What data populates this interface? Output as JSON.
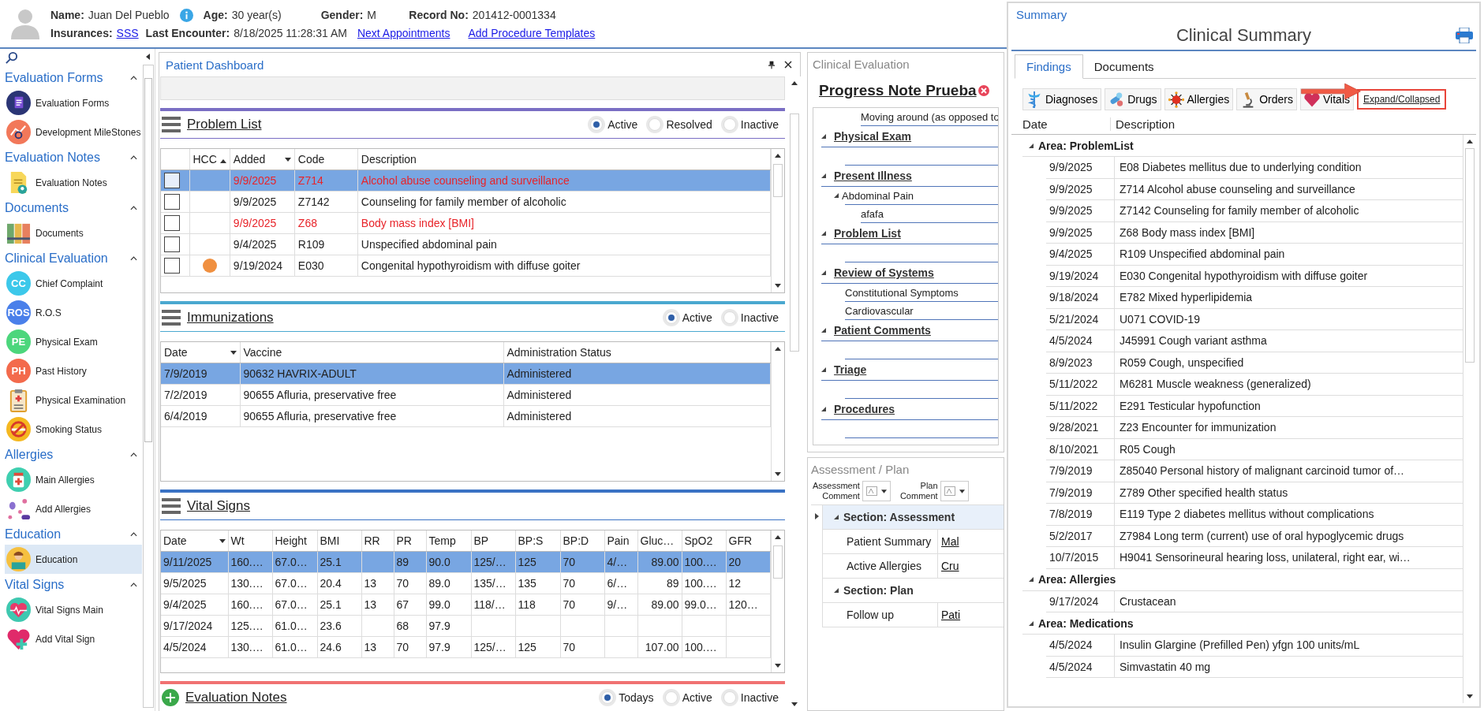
{
  "patient": {
    "name_label": "Name:",
    "name": "Juan Del Pueblo",
    "age_label": "Age:",
    "age": "30 year(s)",
    "gender_label": "Gender:",
    "gender": "M",
    "record_label": "Record No:",
    "record": "201412-0001334",
    "insurances_label": "Insurances:",
    "insurance": "SSS",
    "last_encounter_label": "Last Encounter:",
    "last_encounter": "8/18/2025 11:28:31 AM",
    "links": [
      "Next Appointments",
      "Add Procedure Templates"
    ]
  },
  "sidebar": {
    "groups": [
      {
        "title": "Evaluation Forms",
        "items": [
          {
            "label": "Evaluation Forms",
            "kind": "form",
            "selected": false
          },
          {
            "label": "Development MileStones",
            "kind": "milestones",
            "selected": false
          }
        ]
      },
      {
        "title": "Evaluation Notes",
        "items": [
          {
            "label": "Evaluation Notes",
            "kind": "note",
            "selected": false
          }
        ]
      },
      {
        "title": "Documents",
        "items": [
          {
            "label": "Documents",
            "kind": "binders",
            "selected": false
          }
        ]
      },
      {
        "title": "Clinical Evaluation",
        "items": [
          {
            "label": "Chief Complaint",
            "kind": "badge",
            "badge": "CC",
            "color": "#3cc8ea",
            "selected": false
          },
          {
            "label": "R.O.S",
            "kind": "badge",
            "badge": "ROS",
            "color": "#4a80ea",
            "selected": false
          },
          {
            "label": "Physical Exam",
            "kind": "badge",
            "badge": "PE",
            "color": "#4cd67c",
            "selected": false
          },
          {
            "label": "Past History",
            "kind": "badge",
            "badge": "PH",
            "color": "#f36a4c",
            "selected": false
          },
          {
            "label": "Physical Examination",
            "kind": "clipboard",
            "selected": false
          },
          {
            "label": "Smoking Status",
            "kind": "smoking",
            "selected": false
          }
        ]
      },
      {
        "title": "Allergies",
        "items": [
          {
            "label": "Main Allergies",
            "kind": "medicine",
            "selected": false
          },
          {
            "label": "Add Allergies",
            "kind": "pills",
            "selected": false
          }
        ]
      },
      {
        "title": "Education",
        "items": [
          {
            "label": "Education",
            "kind": "reader",
            "selected": true
          }
        ]
      },
      {
        "title": "Vital Signs",
        "items": [
          {
            "label": "Vital Signs Main",
            "kind": "heart-monitor",
            "selected": false
          },
          {
            "label": "Add Vital Sign",
            "kind": "heart-plus",
            "selected": false
          }
        ]
      }
    ]
  },
  "dashboard": {
    "title": "Patient Dashboard",
    "problem_list": {
      "title": "Problem List",
      "filters": [
        {
          "label": "Active",
          "selected": true
        },
        {
          "label": "Resolved",
          "selected": false
        },
        {
          "label": "Inactive",
          "selected": false
        }
      ],
      "columns": [
        "HCC",
        "Added",
        "Code",
        "Description"
      ],
      "rows": [
        {
          "selected": true,
          "checked": false,
          "hcc": false,
          "alert": true,
          "added": "9/9/2025",
          "code": "Z714",
          "description": "Alcohol abuse counseling and surveillance"
        },
        {
          "selected": false,
          "checked": false,
          "hcc": false,
          "alert": false,
          "added": "9/9/2025",
          "code": "Z7142",
          "description": "Counseling for family member of alcoholic"
        },
        {
          "selected": false,
          "checked": false,
          "hcc": false,
          "alert": true,
          "added": "9/9/2025",
          "code": "Z68",
          "description": "Body mass index [BMI]"
        },
        {
          "selected": false,
          "checked": false,
          "hcc": false,
          "alert": false,
          "added": "9/4/2025",
          "code": "R109",
          "description": "Unspecified abdominal pain"
        },
        {
          "selected": false,
          "checked": false,
          "hcc": true,
          "alert": false,
          "added": "9/19/2024",
          "code": "E030",
          "description": "Congenital hypothyroidism with diffuse goiter"
        }
      ]
    },
    "immunizations": {
      "title": "Immunizations",
      "filters": [
        {
          "label": "Active",
          "selected": true
        },
        {
          "label": "Inactive",
          "selected": false
        }
      ],
      "columns": [
        "Date",
        "Vaccine",
        "Administration Status"
      ],
      "rows": [
        {
          "selected": true,
          "date": "7/9/2019",
          "vaccine": "90632 HAVRIX-ADULT",
          "status": "Administered"
        },
        {
          "selected": false,
          "date": "7/2/2019",
          "vaccine": "90655 Afluria, preservative free",
          "status": "Administered"
        },
        {
          "selected": false,
          "date": "6/4/2019",
          "vaccine": "90655 Afluria, preservative free",
          "status": "Administered"
        }
      ]
    },
    "vital_signs": {
      "title": "Vital Signs",
      "columns": [
        "Date",
        "Wt",
        "Height",
        "BMI",
        "RR",
        "PR",
        "Temp",
        "BP",
        "BP:S",
        "BP:D",
        "Pain",
        "Gluc…",
        "SpO2",
        "GFR"
      ],
      "rows": [
        {
          "selected": true,
          "cells": [
            "9/11/2025",
            "160.…",
            "67.0…",
            "25.1",
            null,
            "89",
            "90.0",
            "125/…",
            "125",
            "70",
            "4/…",
            "89.00",
            "100.…",
            "20"
          ]
        },
        {
          "selected": false,
          "cells": [
            "9/5/2025",
            "130.…",
            "67.0…",
            "20.4",
            "13",
            "70",
            "89.0",
            "135/…",
            "135",
            "70",
            "6/…",
            "89",
            "100.…",
            "12"
          ]
        },
        {
          "selected": false,
          "cells": [
            "9/4/2025",
            "160.…",
            "67.0…",
            "25.1",
            "13",
            "67",
            "99.0",
            "118/…",
            "118",
            "70",
            "9/…",
            "89.00",
            "99.0…",
            "120…"
          ]
        },
        {
          "selected": false,
          "cells": [
            "9/17/2024",
            "125.…",
            "61.0…",
            "23.6",
            null,
            "68",
            "97.9",
            null,
            null,
            null,
            null,
            null,
            null,
            null
          ]
        },
        {
          "selected": false,
          "cells": [
            "4/5/2024",
            "130.…",
            "61.0…",
            "24.6",
            "13",
            "70",
            "97.9",
            "125/…",
            "125",
            "70",
            null,
            "107.00",
            "100.…",
            null
          ]
        }
      ]
    },
    "evaluation_notes": {
      "title": "Evaluation Notes",
      "filters": [
        {
          "label": "Todays",
          "selected": true
        },
        {
          "label": "Active",
          "selected": false
        },
        {
          "label": "Inactive",
          "selected": false
        }
      ]
    }
  },
  "clinical_evaluation": {
    "title": "Clinical Evaluation",
    "note_title": "Progress Note Prueba",
    "top_line": "Moving around (as opposed to",
    "sections": [
      {
        "label": "Physical Exam",
        "expanded": true
      },
      {
        "label": "Present Illness",
        "expanded": true,
        "children": [
          {
            "label": "Abdominal Pain",
            "expanded": true,
            "children": [
              {
                "label": "afafa"
              }
            ]
          }
        ]
      },
      {
        "label": "Problem List",
        "expanded": true
      },
      {
        "label": "Review of Systems",
        "expanded": true,
        "children": [
          {
            "label": "Constitutional Symptoms"
          },
          {
            "label": "Cardiovascular"
          }
        ]
      },
      {
        "label": "Patient Comments",
        "expanded": true
      },
      {
        "label": "Triage",
        "expanded": true
      },
      {
        "label": "Procedures",
        "expanded": true
      }
    ]
  },
  "assessment_plan": {
    "title": "Assessment / Plan",
    "comment_controls": [
      {
        "label_1": "Assessment",
        "label_2": "Comment"
      },
      {
        "label_1": "Plan",
        "label_2": "Comment"
      }
    ],
    "sections": [
      {
        "label": "Section: Assessment",
        "expanded": true,
        "rows": [
          {
            "label": "Patient Summary",
            "value": "Mal"
          },
          {
            "label": "Active Allergies",
            "value": "Cru"
          }
        ]
      },
      {
        "label": "Section: Plan",
        "expanded": true,
        "rows": [
          {
            "label": "Follow up",
            "value": "Pati"
          }
        ]
      }
    ]
  },
  "summary": {
    "title": "Summary",
    "heading": "Clinical Summary",
    "tabs": [
      {
        "label": "Findings",
        "selected": true
      },
      {
        "label": "Documents",
        "selected": false
      }
    ],
    "toolbar": [
      {
        "label": "Diagnoses",
        "kind": "caduceus"
      },
      {
        "label": "Drugs",
        "kind": "pills"
      },
      {
        "label": "Allergies",
        "kind": "virus"
      },
      {
        "label": "Orders",
        "kind": "microscope"
      },
      {
        "label": "Vitals",
        "kind": "heart"
      }
    ],
    "expand_link": "Expand/Collapsed",
    "columns": [
      "Date",
      "Description"
    ],
    "areas": [
      {
        "title": "Area: ProblemList",
        "expanded": true,
        "rows": [
          {
            "date": "9/9/2025",
            "description": "E08 Diabetes mellitus due to underlying condition"
          },
          {
            "date": "9/9/2025",
            "description": "Z714 Alcohol abuse counseling and surveillance"
          },
          {
            "date": "9/9/2025",
            "description": "Z7142 Counseling for family member of alcoholic"
          },
          {
            "date": "9/9/2025",
            "description": "Z68 Body mass index [BMI]"
          },
          {
            "date": "9/4/2025",
            "description": "R109 Unspecified abdominal pain"
          },
          {
            "date": "9/19/2024",
            "description": "E030 Congenital hypothyroidism with diffuse goiter"
          },
          {
            "date": "9/18/2024",
            "description": "E782 Mixed hyperlipidemia"
          },
          {
            "date": "5/21/2024",
            "description": "U071 COVID-19"
          },
          {
            "date": "4/5/2024",
            "description": "J45991 Cough variant asthma"
          },
          {
            "date": "8/9/2023",
            "description": "R059 Cough, unspecified"
          },
          {
            "date": "5/11/2022",
            "description": "M6281 Muscle weakness (generalized)"
          },
          {
            "date": "5/11/2022",
            "description": "E291 Testicular hypofunction"
          },
          {
            "date": "9/28/2021",
            "description": "Z23 Encounter for immunization"
          },
          {
            "date": "8/10/2021",
            "description": "R05 Cough"
          },
          {
            "date": "7/9/2019",
            "description": "Z85040 Personal history of malignant carcinoid tumor of…"
          },
          {
            "date": "7/9/2019",
            "description": "Z789 Other specified health status"
          },
          {
            "date": "7/8/2019",
            "description": "E119 Type 2 diabetes mellitus without complications"
          },
          {
            "date": "5/2/2017",
            "description": "Z7984 Long term (current) use of oral hypoglycemic drugs"
          },
          {
            "date": "10/7/2015",
            "description": "H9041 Sensorineural hearing loss, unilateral, right ear, wi…"
          }
        ]
      },
      {
        "title": "Area: Allergies",
        "expanded": true,
        "rows": [
          {
            "date": "9/17/2024",
            "description": "Crustacean"
          }
        ]
      },
      {
        "title": "Area: Medications",
        "expanded": true,
        "rows": [
          {
            "date": "4/5/2024",
            "description": "Insulin Glargine (Prefilled Pen) yfgn 100 units/mL"
          },
          {
            "date": "4/5/2024",
            "description": "Simvastatin 40 mg"
          }
        ]
      }
    ]
  }
}
